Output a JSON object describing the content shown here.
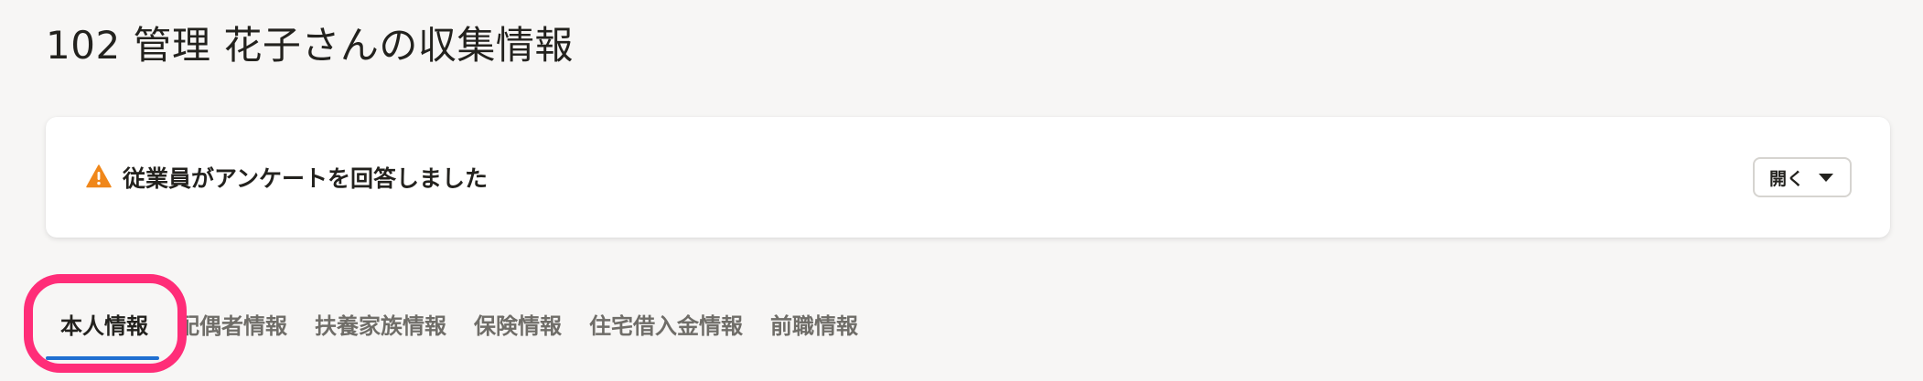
{
  "page": {
    "title": "102 管理 花子さんの収集情報"
  },
  "notice": {
    "icon": "warning-icon",
    "icon_color": "#f0871a",
    "message": "従業員がアンケートを回答しました",
    "open_label": "開く",
    "dropdown_icon": "caret-down-icon"
  },
  "tabs": [
    {
      "label": "本人情報",
      "active": true
    },
    {
      "label": "配偶者情報",
      "active": false
    },
    {
      "label": "扶養家族情報",
      "active": false
    },
    {
      "label": "保険情報",
      "active": false
    },
    {
      "label": "住宅借入金情報",
      "active": false
    },
    {
      "label": "前職情報",
      "active": false
    }
  ],
  "colors": {
    "active_tab_underline": "#1f6fd1",
    "highlight_annotation": "#ff2d78"
  }
}
